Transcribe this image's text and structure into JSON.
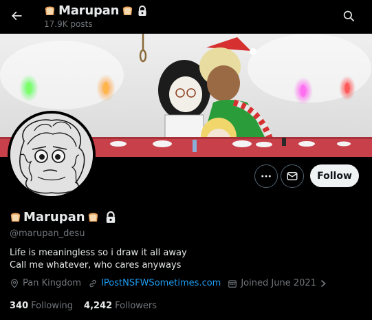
{
  "header": {
    "title": "Marupan",
    "subtitle": "17.9K posts",
    "back_icon": "arrow-left-icon",
    "search_icon": "search-icon"
  },
  "profile": {
    "display_name": "Marupan",
    "handle": "@marupan_desu",
    "bio_lines": [
      "Life is meaningless so i draw it all away",
      "Call me whatever, who cares anyways"
    ],
    "location": "Pan Kingdom",
    "website": "IPostNSFWSometimes.com",
    "joined": "Joined June 2021",
    "protected": true
  },
  "actions": {
    "more_icon": "more-horizontal-icon",
    "message_icon": "mail-icon",
    "follow_label": "Follow"
  },
  "stats": {
    "following_count": "340",
    "following_label": "Following",
    "followers_count": "4,242",
    "followers_label": "Followers"
  },
  "colors": {
    "background": "#000000",
    "text_primary": "#e7e9ea",
    "text_secondary": "#71767b",
    "link": "#1d9bf0",
    "follow_bg": "#eff3f4"
  }
}
